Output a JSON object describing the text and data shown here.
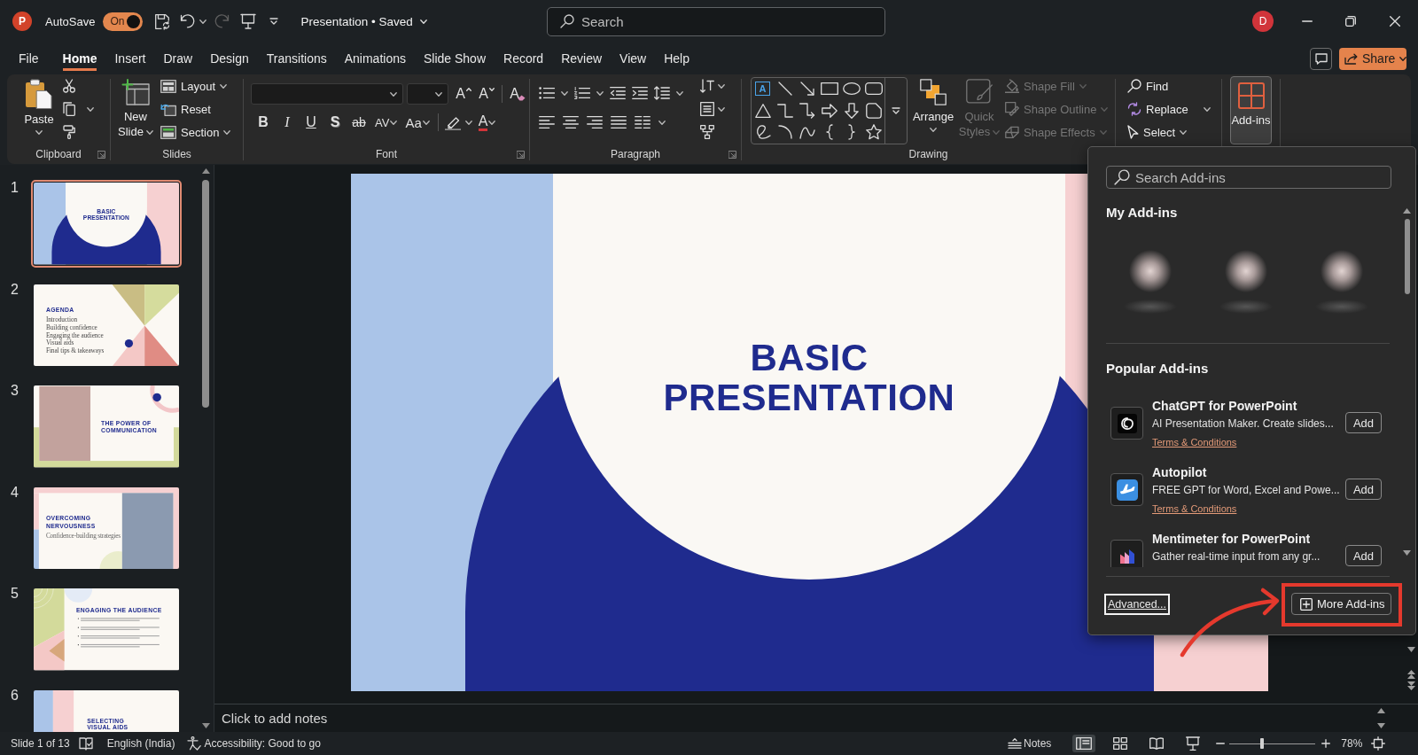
{
  "title_bar": {
    "logo": "P",
    "autosave_label": "AutoSave",
    "autosave": {
      "label": "On",
      "on": true
    },
    "quick_access": [
      {
        "kind": "save",
        "disabled": false
      },
      {
        "kind": "undo",
        "disabled": false
      },
      {
        "kind": "redo",
        "disabled": true
      },
      {
        "kind": "present",
        "disabled": false
      },
      {
        "kind": "customize",
        "disabled": false
      }
    ],
    "document_title": "Presentation • Saved",
    "search": {
      "placeholder": "Search"
    },
    "avatar": "D"
  },
  "tabs": [
    {
      "label": "File",
      "selected": false
    },
    {
      "label": "Home",
      "selected": true
    },
    {
      "label": "Insert",
      "selected": false
    },
    {
      "label": "Draw",
      "selected": false
    },
    {
      "label": "Design",
      "selected": false
    },
    {
      "label": "Transitions",
      "selected": false
    },
    {
      "label": "Animations",
      "selected": false
    },
    {
      "label": "Slide Show",
      "selected": false
    },
    {
      "label": "Record",
      "selected": false
    },
    {
      "label": "Review",
      "selected": false
    },
    {
      "label": "View",
      "selected": false
    },
    {
      "label": "Help",
      "selected": false
    }
  ],
  "share_button": "Share",
  "ribbon": {
    "clipboard": {
      "label": "Clipboard",
      "paste": "Paste"
    },
    "slides": {
      "label": "Slides",
      "new_slide": "New Slide",
      "buttons": [
        {
          "kind": "layout",
          "label": "Layout",
          "dropdown": true
        },
        {
          "kind": "reset",
          "label": "Reset",
          "dropdown": false
        },
        {
          "kind": "section",
          "label": "Section",
          "dropdown": true
        }
      ]
    },
    "font": {
      "label": "Font",
      "top_row": [
        {
          "kind": "grow",
          "glyph": "A"
        },
        {
          "kind": "shrink",
          "glyph": "A"
        },
        {
          "kind": "clear",
          "glyph": "A"
        }
      ],
      "bottom_row": [
        {
          "kind": "bold",
          "glyph": "B"
        },
        {
          "kind": "italic",
          "glyph": "I"
        },
        {
          "kind": "underline",
          "glyph": "U"
        },
        {
          "kind": "shadow",
          "glyph": "S"
        },
        {
          "kind": "strike",
          "glyph": "ab"
        },
        {
          "kind": "spacing",
          "glyph": "AV"
        },
        {
          "kind": "case",
          "glyph": "Aa"
        },
        {
          "kind": "highlight"
        },
        {
          "kind": "color",
          "glyph": "A"
        }
      ]
    },
    "paragraph": {
      "label": "Paragraph"
    },
    "drawing": {
      "label": "Drawing",
      "shapes": [
        {
          "kind": "textbox",
          "glyph": "A"
        },
        {
          "kind": "line"
        },
        {
          "kind": "arrow-line"
        },
        {
          "kind": "rectangle"
        },
        {
          "kind": "oval"
        },
        {
          "kind": "rounded-rectangle"
        },
        {
          "kind": "triangle"
        },
        {
          "kind": "elbow"
        },
        {
          "kind": "elbow-arrow"
        },
        {
          "kind": "right-arrow"
        },
        {
          "kind": "down-arrow"
        },
        {
          "kind": "snip"
        },
        {
          "kind": "freeform"
        },
        {
          "kind": "arc"
        },
        {
          "kind": "curve"
        },
        {
          "kind": "left-brace"
        },
        {
          "kind": "right-brace"
        },
        {
          "kind": "star"
        }
      ],
      "arrange": "Arrange",
      "quick_styles": {
        "label": "Quick Styles",
        "disabled": true
      },
      "format": [
        {
          "kind": "fill",
          "label": "Shape Fill",
          "disabled": true
        },
        {
          "kind": "outline",
          "label": "Shape Outline",
          "disabled": true
        },
        {
          "kind": "effects",
          "label": "Shape Effects",
          "disabled": true
        }
      ]
    },
    "editing": {
      "buttons": [
        {
          "kind": "find",
          "label": "Find",
          "dropdown": false
        },
        {
          "kind": "replace",
          "label": "Replace",
          "dropdown": true
        },
        {
          "kind": "select",
          "label": "Select",
          "dropdown": true
        }
      ]
    },
    "addins": {
      "label": "Add-ins",
      "selected": true
    }
  },
  "slides": [
    {
      "number": "1",
      "selected": true,
      "kind": "title",
      "title": "BASIC PRESENTATION"
    },
    {
      "number": "2",
      "selected": false,
      "kind": "agenda",
      "title": "AGENDA",
      "items": [
        "Introduction",
        "Building confidence",
        "Engaging the audience",
        "Visual aids",
        "Final tips & takeaways"
      ]
    },
    {
      "number": "3",
      "selected": false,
      "kind": "photo-left",
      "title": "THE POWER OF COMMUNICATION"
    },
    {
      "number": "4",
      "selected": false,
      "kind": "photo-right",
      "title": "OVERCOMING NERVOUSNESS",
      "subtitle": "Confidence-building strategies"
    },
    {
      "number": "5",
      "selected": false,
      "kind": "bullets",
      "title": "ENGAGING THE AUDIENCE"
    },
    {
      "number": "6",
      "selected": false,
      "kind": "section",
      "title": "SELECTING VISUAL AIDS"
    }
  ],
  "editor": {
    "slide": {
      "kind": "title",
      "title": "BASIC PRESENTATION"
    }
  },
  "notes": {
    "placeholder": "Click to add notes"
  },
  "status_bar": {
    "slide_info": "Slide 1 of 13",
    "language": "English (India)",
    "accessibility": "Accessibility: Good to go",
    "notes": "Notes",
    "views": [
      {
        "kind": "normal",
        "selected": true
      },
      {
        "kind": "sorter",
        "selected": false
      },
      {
        "kind": "reading",
        "selected": false
      },
      {
        "kind": "slideshow",
        "selected": false
      }
    ],
    "zoom": {
      "level": 0.38,
      "reading": "78%"
    }
  },
  "addins_panel": {
    "search": {
      "placeholder": "Search Add-ins"
    },
    "my_heading": "My Add-ins",
    "popular_heading": "Popular Add-ins",
    "items": [
      {
        "kind": "swirl",
        "name": "ChatGPT for PowerPoint",
        "description": "AI Presentation Maker. Create slides...",
        "link": "Terms & Conditions",
        "button": "Add"
      },
      {
        "kind": "plane",
        "name": "Autopilot",
        "description": "FREE GPT for Word, Excel and Powe...",
        "link": "Terms & Conditions",
        "button": "Add"
      },
      {
        "kind": "bars",
        "name": "Mentimeter for PowerPoint",
        "description": "Gather real-time input from any gr...",
        "button": "Add"
      }
    ],
    "advanced": "Advanced...",
    "more_button": "More Add-ins"
  }
}
